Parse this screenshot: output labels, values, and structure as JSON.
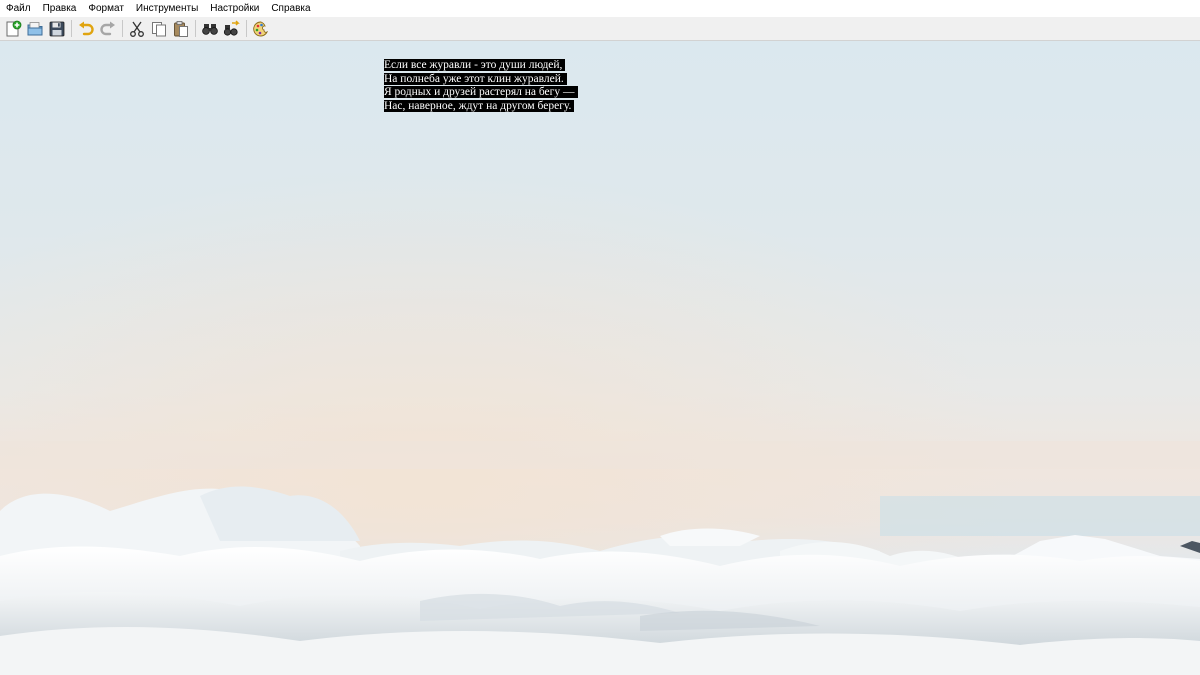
{
  "menu": {
    "items": [
      "Файл",
      "Правка",
      "Формат",
      "Инструменты",
      "Настройки",
      "Справка"
    ]
  },
  "toolbar": {
    "buttons": [
      {
        "name": "new-document-icon"
      },
      {
        "name": "open-file-icon"
      },
      {
        "name": "save-icon"
      },
      {
        "name": "undo-icon"
      },
      {
        "name": "redo-icon"
      },
      {
        "name": "cut-icon"
      },
      {
        "name": "copy-icon"
      },
      {
        "name": "paste-icon"
      },
      {
        "name": "find-icon"
      },
      {
        "name": "replace-icon"
      },
      {
        "name": "color-palette-icon"
      }
    ]
  },
  "document": {
    "lines": [
      "Если все журавли - это души людей,",
      "На полнеба уже этот клин журавлей.",
      "Я родных и друзей растерял на бегу —",
      "Нас, наверное, ждут на другом берегу."
    ],
    "highlight_color": "#000000",
    "text_color": "#ffffff"
  }
}
